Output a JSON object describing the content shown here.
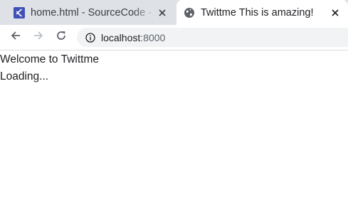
{
  "browser": {
    "tabs": [
      {
        "title": "home.html - SourceCode - Visual Studio Code",
        "favicon": "vscode-icon",
        "active": false
      },
      {
        "title": "Twittme This is amazing!",
        "favicon": "globe-icon",
        "active": true
      }
    ],
    "address": {
      "host": "localhost",
      "port": ":8000"
    }
  },
  "page": {
    "welcome": "Welcome to Twittme",
    "status": "Loading..."
  }
}
